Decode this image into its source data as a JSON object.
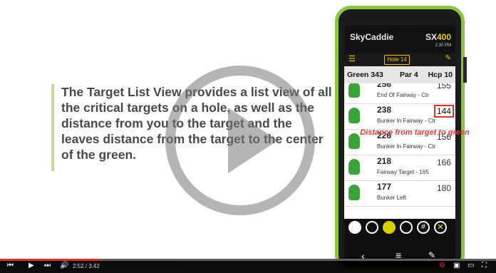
{
  "left_panel": {
    "description": "The Target List View provides a list view of all the critical targets on a hole, as well as the distance from you to the target and the leaves distance from the target to the center of the green."
  },
  "phone": {
    "brand": "SkyCaddie",
    "model_prefix": "SX",
    "model_number": "400",
    "status_time": "2:30 PM",
    "hole_select": "Hole 14",
    "header": {
      "green": "Green 343",
      "par": "Par 4",
      "hcp": "Hcp 10"
    },
    "targets": [
      {
        "yards": "256",
        "name": "End Of Fairway - Ctr",
        "distance": "155"
      },
      {
        "yards": "238",
        "name": "Bunker In Fairway - Ctr",
        "distance": "144"
      },
      {
        "yards": "226",
        "name": "Bunker In Fairway - Ctr",
        "distance": "156"
      },
      {
        "yards": "218",
        "name": "Fairway Target - 165",
        "distance": "166"
      },
      {
        "yards": "177",
        "name": "Bunker Left",
        "distance": "180"
      }
    ],
    "annotation": "Distance from target to green",
    "tool_bar": {
      "btn5": "#",
      "btn6": "✕"
    },
    "nav": {
      "back": "‹",
      "home": "≡",
      "edit": "✎"
    }
  },
  "player": {
    "time": "2:52 / 3:42",
    "progress_fraction": 0.2
  },
  "colors": {
    "accent_green": "#8bc53f",
    "accent_yellow": "#f7c300",
    "highlight_red": "#e0302b"
  }
}
